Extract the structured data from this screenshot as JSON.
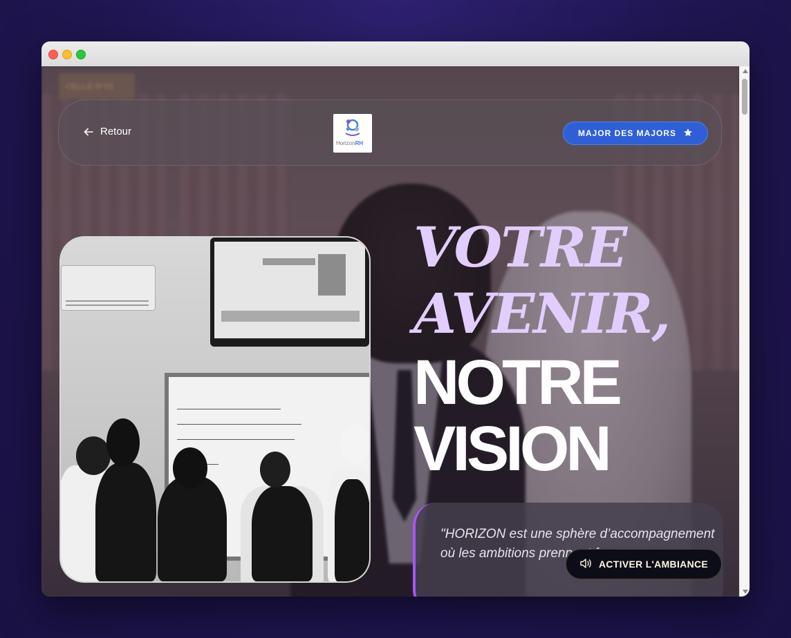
{
  "nav": {
    "back_label": "Retour",
    "logo": {
      "text_light": "Horizon",
      "text_bold": "RH"
    },
    "major_button_label": "MAJOR DES MAJORS"
  },
  "hero": {
    "line1": "VOTRE",
    "line2": "AVENIR,",
    "line3": "NOTRE",
    "line4": "VISION"
  },
  "quote": {
    "text": "\"HORIZON est une sphère d’accompagnement où les ambitions prennent forme"
  },
  "ambiance_button_label": "ACTIVER L'AMBIANCE",
  "colors": {
    "accent_purple": "#a855f7",
    "headline_italic": "#e2cdfc",
    "primary_blue": "#2f5fd8"
  },
  "icons": {
    "back": "arrow-left-icon",
    "major": "star-icon",
    "ambiance": "speaker-icon"
  }
}
